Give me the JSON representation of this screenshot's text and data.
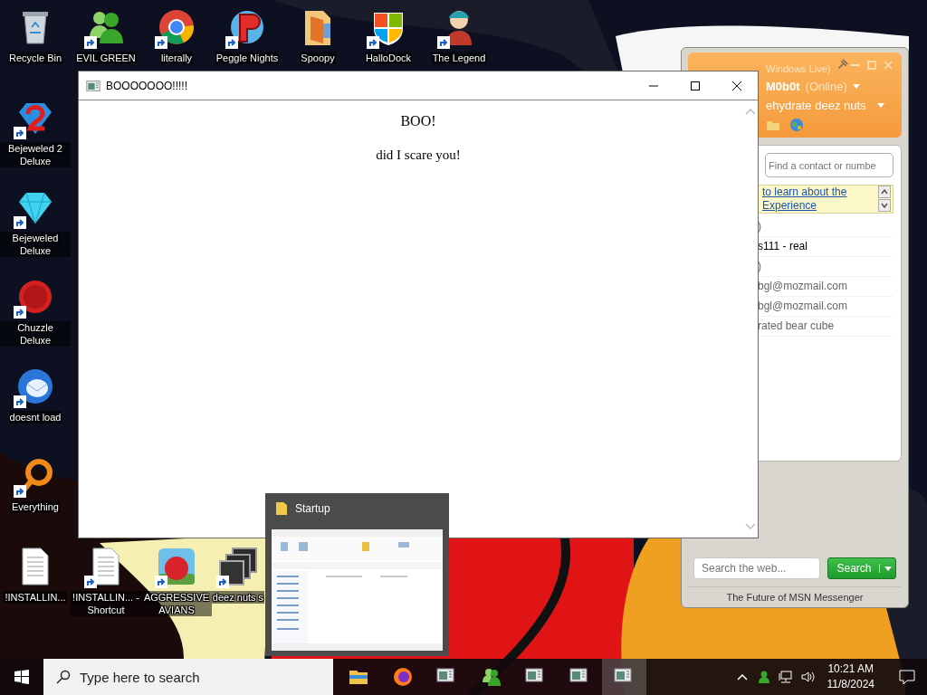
{
  "desktop_icons": [
    {
      "label": "Recycle Bin",
      "kind": "recycle-bin",
      "shortcut": false
    },
    {
      "label": "EVIL GREEN",
      "kind": "messenger",
      "shortcut": true
    },
    {
      "label": "literally",
      "kind": "browser",
      "shortcut": true
    },
    {
      "label": "Peggle Nights",
      "kind": "peggle",
      "shortcut": true
    },
    {
      "label": "Spoopy",
      "kind": "folder",
      "shortcut": false
    },
    {
      "label": "HalloDock",
      "kind": "shield",
      "shortcut": true
    },
    {
      "label": "The Legend",
      "kind": "character",
      "shortcut": true
    },
    {
      "label": "Bejeweled 2 Deluxe",
      "kind": "gem2",
      "shortcut": true
    },
    {
      "label": "Bejeweled Deluxe",
      "kind": "gem",
      "shortcut": true
    },
    {
      "label": "Chuzzle Deluxe",
      "kind": "fuzzball",
      "shortcut": true
    },
    {
      "label": "doesnt load",
      "kind": "mail",
      "shortcut": true
    },
    {
      "label": "Everything",
      "kind": "magnifier",
      "shortcut": true
    },
    {
      "label": "!INSTALLIN...",
      "kind": "document",
      "shortcut": false
    },
    {
      "label": "!INSTALLIN... - Shortcut",
      "kind": "document",
      "shortcut": true
    },
    {
      "label": "AGGRESSIVE AVIANS",
      "kind": "app-tile",
      "shortcut": true
    },
    {
      "label": "deez nuts s",
      "kind": "stack",
      "shortcut": true
    }
  ],
  "messenger": {
    "header_title": "Windows Live)",
    "user_name": "M0b0t",
    "status": "(Online)",
    "personal_message": "ehydrate deez nuts",
    "contact_search_placeholder": "Find a contact or numbe",
    "banner_lines": [
      "to learn about the",
      "Experience"
    ],
    "contacts": [
      {
        "text": ")",
        "kind": "group"
      },
      {
        "text": "s111 - real",
        "kind": "online"
      },
      {
        "text": ")",
        "kind": "group"
      },
      {
        "text": "bgl@mozmail.com",
        "kind": "offline"
      },
      {
        "text": "bgl@mozmail.com",
        "kind": "offline"
      },
      {
        "text": "rated bear cube",
        "kind": "offline"
      }
    ],
    "web_search_placeholder": "Search the web...",
    "search_button": "Search",
    "footer": "The Future of MSN Messenger"
  },
  "main_window": {
    "title": "BOOOOOOO!!!!!",
    "heading": "BOO!",
    "message": "did I scare you!"
  },
  "thumbnail": {
    "title": "Startup"
  },
  "taskbar": {
    "search_placeholder": "Type here to search",
    "apps": [
      {
        "kind": "explorer",
        "active": false
      },
      {
        "kind": "firefox",
        "active": false
      },
      {
        "kind": "window",
        "active": false
      },
      {
        "kind": "messenger",
        "active": false
      },
      {
        "kind": "window",
        "active": false
      },
      {
        "kind": "window",
        "active": false
      },
      {
        "kind": "window",
        "active": true
      }
    ],
    "time": "10:21 AM",
    "date": "11/8/2024"
  }
}
